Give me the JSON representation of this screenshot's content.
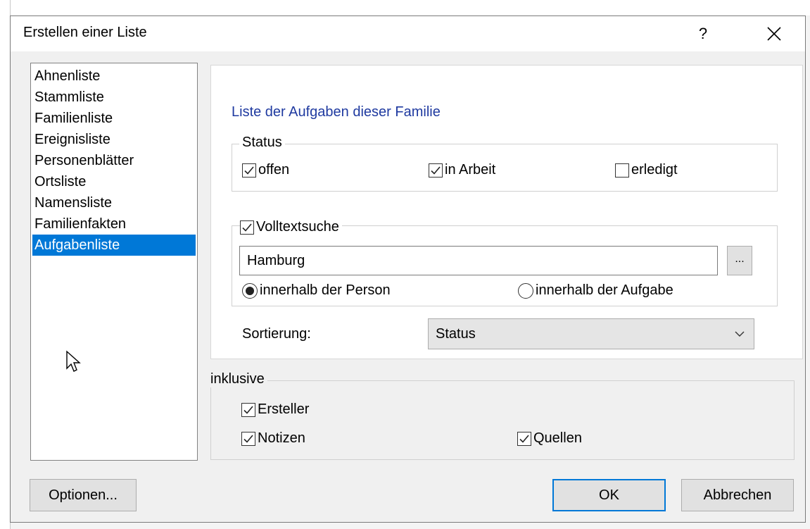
{
  "dialog": {
    "title": "Erstellen einer Liste",
    "help_glyph": "?",
    "close_glyph": "✕"
  },
  "list": {
    "items": [
      "Ahnenliste",
      "Stammliste",
      "Familienliste",
      "Ereignisliste",
      "Personenblätter",
      "Ortsliste",
      "Namensliste",
      "Familienfakten",
      "Aufgabenliste"
    ],
    "selected_index": 8
  },
  "panel": {
    "heading": "Liste der Aufgaben dieser Familie",
    "status": {
      "legend": "Status",
      "offen": {
        "label": "offen",
        "checked": true
      },
      "in_arbeit": {
        "label": "in Arbeit",
        "checked": true
      },
      "erledigt": {
        "label": "erledigt",
        "checked": false
      }
    },
    "fulltext": {
      "label": "Volltextsuche",
      "checked": true,
      "value": "Hamburg",
      "browse_label": "...",
      "radio_person": {
        "label": "innerhalb der Person",
        "selected": true
      },
      "radio_task": {
        "label": "innerhalb der Aufgabe",
        "selected": false
      }
    },
    "sort": {
      "label": "Sortierung:",
      "value": "Status"
    }
  },
  "inklusive": {
    "legend": "inklusive",
    "ersteller": {
      "label": "Ersteller",
      "checked": true
    },
    "notizen": {
      "label": "Notizen",
      "checked": true
    },
    "quellen": {
      "label": "Quellen",
      "checked": true
    }
  },
  "buttons": {
    "options": "Optionen...",
    "ok": "OK",
    "cancel": "Abbrechen"
  },
  "colors": {
    "selection": "#0078d7",
    "heading": "#1f3aa0"
  }
}
